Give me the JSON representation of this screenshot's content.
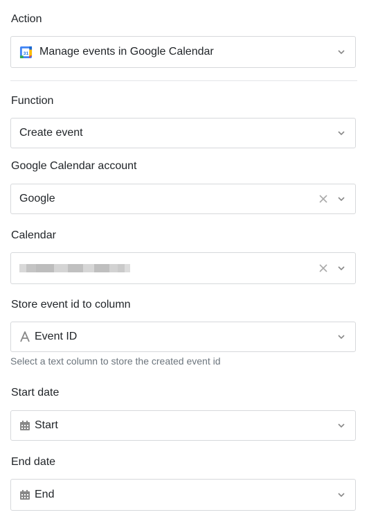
{
  "action": {
    "label": "Action",
    "value": "Manage events in Google Calendar",
    "icon": "google-calendar-icon"
  },
  "function": {
    "label": "Function",
    "value": "Create event"
  },
  "account": {
    "label": "Google Calendar account",
    "value": "Google"
  },
  "calendar": {
    "label": "Calendar",
    "value": ""
  },
  "store_event": {
    "label": "Store event id to column",
    "value": "Event ID",
    "icon": "text-column-icon",
    "hint": "Select a text column to store the created event id"
  },
  "start_date": {
    "label": "Start date",
    "value": "Start",
    "icon": "calendar-icon"
  },
  "end_date": {
    "label": "End date",
    "value": "End",
    "icon": "calendar-icon"
  },
  "colors": {
    "border": "#d6d8db",
    "text": "#212529",
    "hint": "#6c757d",
    "icon": "#888888"
  }
}
